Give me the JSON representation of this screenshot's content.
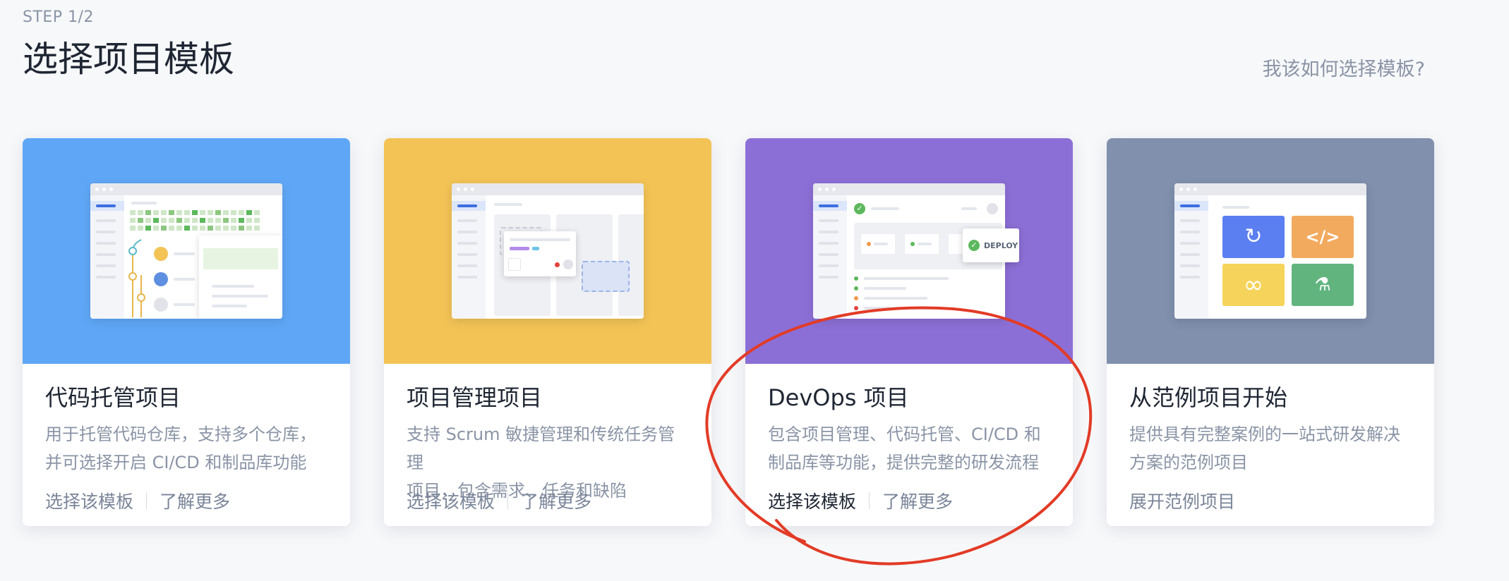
{
  "header": {
    "step": "STEP 1/2",
    "title": "选择项目模板",
    "help_link": "我该如何选择模板?"
  },
  "cards": [
    {
      "title": "代码托管项目",
      "desc_line1": "用于托管代码仓库，支持多个仓库，",
      "desc_line2": "并可选择开启 CI/CD 和制品库功能",
      "action_primary": "选择该模板",
      "action_secondary": "了解更多",
      "banner_color": "#5fa7f6"
    },
    {
      "title": "项目管理项目",
      "desc_line1": "支持 Scrum 敏捷管理和传统任务管理",
      "desc_line2": "项目，包含需求、任务和缺陷",
      "action_primary": "选择该模板",
      "action_secondary": "了解更多",
      "banner_color": "#f3c356"
    },
    {
      "title": "DevOps 项目",
      "desc_line1": "包含项目管理、代码托管、CI/CD 和",
      "desc_line2": "制品库等功能，提供完整的研发流程",
      "action_primary": "选择该模板",
      "action_secondary": "了解更多",
      "banner_color": "#8c6fd6",
      "deploy_label": "DEPLOY"
    },
    {
      "title": "从范例项目开始",
      "desc_line1": "提供具有完整案例的一站式研发解决",
      "desc_line2": "方案的范例项目",
      "action_primary": "展开范例项目",
      "banner_color": "#8090ad"
    }
  ],
  "colors": {
    "accent_blue": "#3d6de0",
    "green": "#5cb85c",
    "annotation_red": "#e23b26"
  }
}
